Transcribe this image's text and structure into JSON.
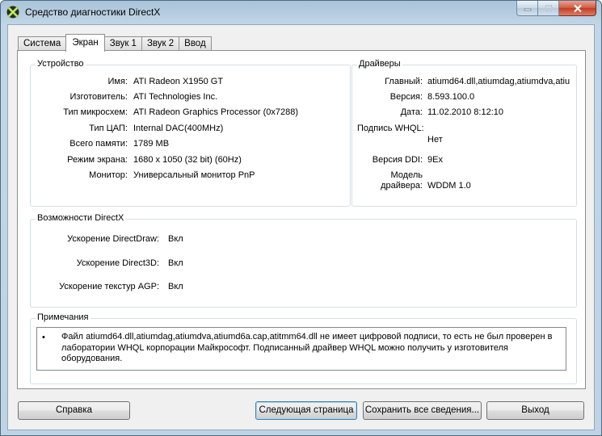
{
  "window": {
    "title": "Средство диагностики DirectX",
    "icon": "directx-icon"
  },
  "tabs": [
    "Система",
    "Экран",
    "Звук 1",
    "Звук 2",
    "Ввод"
  ],
  "active_tab": "Экран",
  "device": {
    "title": "Устройство",
    "rows": [
      {
        "label": "Имя:",
        "value": "ATI Radeon X1950 GT"
      },
      {
        "label": "Изготовитель:",
        "value": "ATI Technologies Inc."
      },
      {
        "label": "Тип микросхем:",
        "value": "ATI Radeon Graphics Processor (0x7288)"
      },
      {
        "label": "Тип ЦАП:",
        "value": "Internal DAC(400MHz)"
      },
      {
        "label": "Всего памяти:",
        "value": "1789 MB"
      },
      {
        "label": "Режим экрана:",
        "value": "1680 x 1050 (32 bit) (60Hz)"
      },
      {
        "label": "Монитор:",
        "value": "Универсальный монитор PnP"
      }
    ]
  },
  "drivers": {
    "title": "Драйверы",
    "rows": [
      {
        "label": "Главный:",
        "value": "atiumd64.dll,atiumdag,atiumdva,atiu"
      },
      {
        "label": "Версия:",
        "value": "8.593.100.0"
      },
      {
        "label": "Дата:",
        "value": "11.02.2010 8:12:10"
      },
      {
        "label": "Подпись WHQL:",
        "value": "Нет"
      },
      {
        "label": "Версия DDI:",
        "value": "9Ex"
      },
      {
        "label_line1": "Модель",
        "label_line2": "драйвера:",
        "value": "WDDM 1.0"
      }
    ]
  },
  "features": {
    "title": "Возможности DirectX",
    "rows": [
      {
        "label": "Ускорение DirectDraw:",
        "value": "Вкл"
      },
      {
        "label": "Ускорение Direct3D:",
        "value": "Вкл"
      },
      {
        "label": "Ускорение текстур AGP:",
        "value": "Вкл"
      }
    ]
  },
  "notes": {
    "title": "Примечания",
    "bullet": "•",
    "line1": "Файл atiumd64.dll,atiumdag,atiumdva,atiumd6a.cap,atitmm64.dll не имеет цифровой подписи, то есть не был проверен в",
    "line2": "лаборатории WHQL корпорации Майкрософт. Подписанный драйвер WHQL можно получить у изготовителя",
    "line3": "оборудования."
  },
  "buttons": {
    "help": "Справка",
    "next": "Следующая страница",
    "save": "Сохранить все сведения...",
    "exit": "Выход"
  }
}
